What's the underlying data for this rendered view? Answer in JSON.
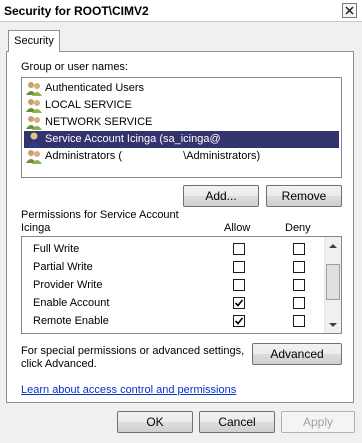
{
  "window": {
    "title": "Security for ROOT\\CIMV2",
    "close_icon": "close-icon"
  },
  "tabs": [
    {
      "label": "Security",
      "selected": true
    }
  ],
  "group": {
    "label": "Group or user names:",
    "items": [
      {
        "label": "Authenticated Users",
        "icon": "users-group-icon",
        "selected": false
      },
      {
        "label": "LOCAL SERVICE",
        "icon": "users-group-icon",
        "selected": false
      },
      {
        "label": "NETWORK SERVICE",
        "icon": "users-group-icon",
        "selected": false
      },
      {
        "label": "Service Account Icinga (sa_icinga@",
        "icon": "user-icon",
        "selected": true
      },
      {
        "label": "Administrators (                    \\Administrators)",
        "icon": "users-group-icon",
        "selected": false
      }
    ],
    "add_label": "Add...",
    "remove_label": "Remove"
  },
  "permissions": {
    "header_line1": "Permissions for Service Account",
    "header_line2": "Icinga",
    "allow_header": "Allow",
    "deny_header": "Deny",
    "rows": [
      {
        "name": "Full Write",
        "allow": false,
        "deny": false
      },
      {
        "name": "Partial Write",
        "allow": false,
        "deny": false
      },
      {
        "name": "Provider Write",
        "allow": false,
        "deny": false
      },
      {
        "name": "Enable Account",
        "allow": true,
        "deny": false
      },
      {
        "name": "Remote Enable",
        "allow": true,
        "deny": false
      }
    ]
  },
  "advanced": {
    "text_line1": "For special permissions or advanced settings,",
    "text_line2": "click Advanced.",
    "button_label": "Advanced"
  },
  "link_text": "Learn about access control and permissions",
  "footer": {
    "ok_label": "OK",
    "cancel_label": "Cancel",
    "apply_label": "Apply",
    "apply_enabled": false
  },
  "colors": {
    "selection": "#33336d",
    "link": "#0033cc"
  }
}
